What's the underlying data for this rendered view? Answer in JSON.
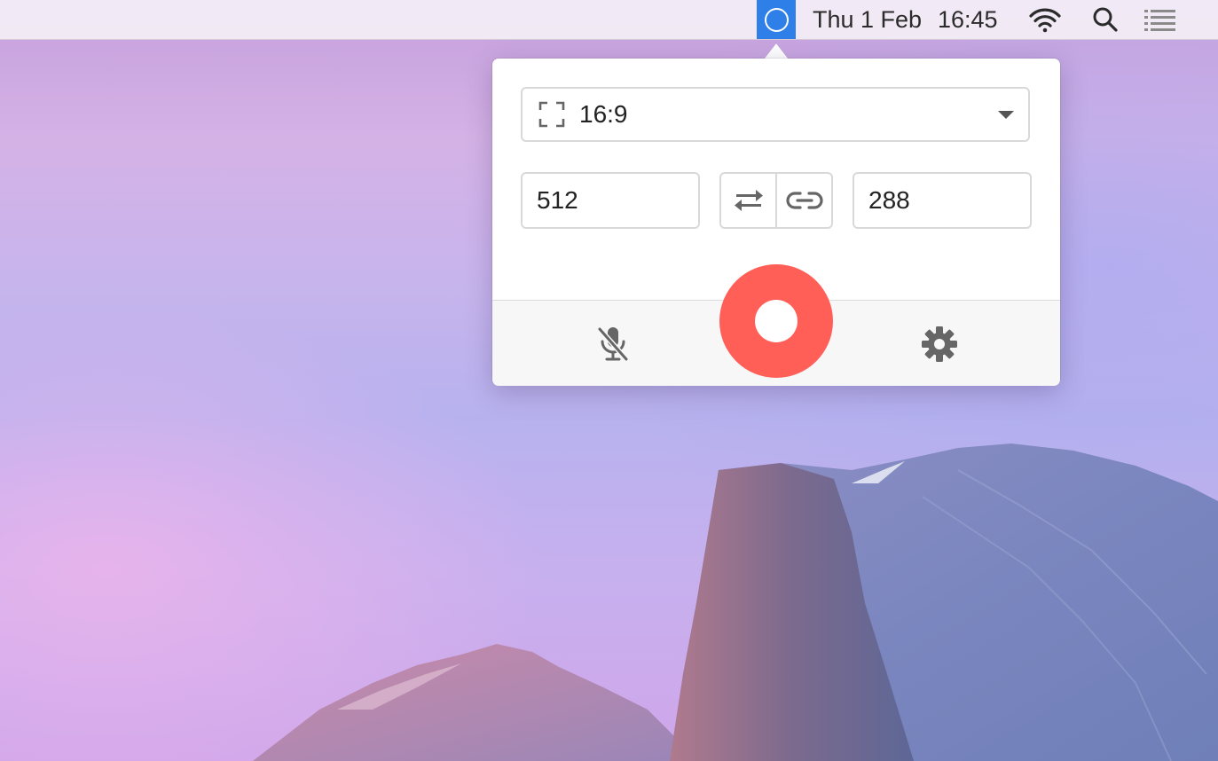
{
  "menubar": {
    "status_app_icon": "circle-outline-icon",
    "date": "Thu 1 Feb",
    "time": "16:45",
    "icons": [
      "wifi-icon",
      "search-icon",
      "list-icon"
    ]
  },
  "popover": {
    "aspect_ratio": {
      "icon": "crop-frame-icon",
      "value": "16:9"
    },
    "width_value": "512",
    "height_value": "288",
    "swap_icon": "swap-arrows-icon",
    "link_icon": "link-icon",
    "footer": {
      "mic_icon": "microphone-muted-icon",
      "record_icon": "record-icon",
      "settings_icon": "gear-icon"
    }
  },
  "colors": {
    "status_app_highlight": "#2f7fe9",
    "record": "#ff5f57",
    "border": "#d9d9d9",
    "icon": "#666666"
  }
}
